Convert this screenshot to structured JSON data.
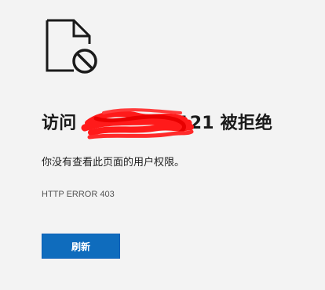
{
  "icon": {
    "name": "blocked-document-icon"
  },
  "error": {
    "title_prefix": "访问 ",
    "title_domain_visible_tail": "121",
    "title_suffix": " 被拒绝",
    "message": "你没有查看此页面的用户权限。",
    "code": "HTTP ERROR 403"
  },
  "actions": {
    "refresh_label": "刷新"
  },
  "colors": {
    "background": "#f3f3f3",
    "primary_button": "#0f6cbd",
    "redaction": "#ff1a1a"
  }
}
